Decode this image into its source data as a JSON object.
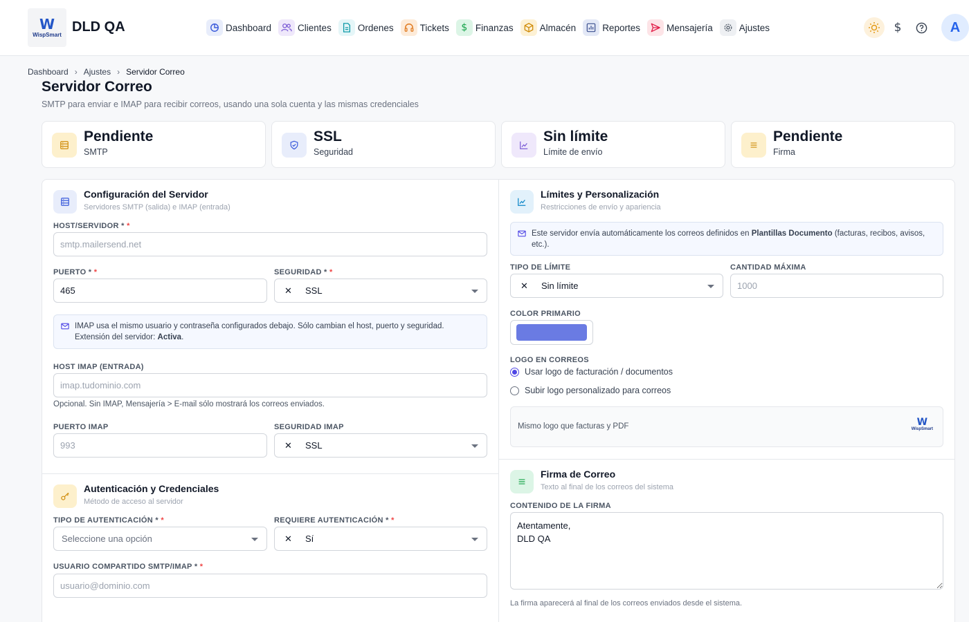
{
  "app": {
    "title": "DLD QA",
    "logo_text": "WispSmart",
    "logo_letter": "W"
  },
  "nav": [
    {
      "label": "Dashboard",
      "icon": "chart-pie-icon",
      "bg": "#e8edfb",
      "fg": "#3b5bdb"
    },
    {
      "label": "Clientes",
      "icon": "users-icon",
      "bg": "#efe8fb",
      "fg": "#7c5cd6"
    },
    {
      "label": "Ordenes",
      "icon": "document-icon",
      "bg": "#e5f6f8",
      "fg": "#0e9aa7"
    },
    {
      "label": "Tickets",
      "icon": "headset-icon",
      "bg": "#fdebd9",
      "fg": "#e07a1f"
    },
    {
      "label": "Finanzas",
      "icon": "dollar-icon",
      "bg": "#dcf5e6",
      "fg": "#16a34a"
    },
    {
      "label": "Almacén",
      "icon": "box-icon",
      "bg": "#fdf1d4",
      "fg": "#d08c0b"
    },
    {
      "label": "Reportes",
      "icon": "bar-chart-icon",
      "bg": "#e3e8f6",
      "fg": "#3b4f8f"
    },
    {
      "label": "Mensajería",
      "icon": "send-icon",
      "bg": "#fde4e7",
      "fg": "#e11d48"
    },
    {
      "label": "Ajustes",
      "icon": "gear-icon",
      "bg": "#eef0f3",
      "fg": "#4b5563"
    }
  ],
  "topright": {
    "avatar_letter": "A"
  },
  "breadcrumb": [
    "Dashboard",
    "Ajustes",
    "Servidor Correo"
  ],
  "page": {
    "title": "Servidor Correo",
    "subtitle": "SMTP para enviar e IMAP para recibir correos, usando una sola cuenta y las mismas credenciales"
  },
  "stats": [
    {
      "value": "Pendiente",
      "label": "SMTP",
      "icon": "server-icon",
      "bg": "#fdf0cc",
      "fg": "#d08c0b"
    },
    {
      "value": "SSL",
      "label": "Seguridad",
      "icon": "shield-icon",
      "bg": "#e8edfb",
      "fg": "#3b5bdb"
    },
    {
      "value": "Sin límite",
      "label": "Límite de envío",
      "icon": "trend-icon",
      "bg": "#efe8fb",
      "fg": "#7c5cd6"
    },
    {
      "value": "Pendiente",
      "label": "Firma",
      "icon": "lines-icon",
      "bg": "#fdf0cc",
      "fg": "#d08c0b"
    }
  ],
  "server": {
    "title": "Configuración del Servidor",
    "subtitle": "Servidores SMTP (salida) e IMAP (entrada)",
    "host_label": "HOST/SERVIDOR *",
    "host_placeholder": "smtp.mailersend.net",
    "port_label": "PUERTO *",
    "port_value": "465",
    "security_label": "SEGURIDAD *",
    "security_value": "SSL",
    "imap_info_1": "IMAP usa el mismo usuario y contraseña configurados debajo. Sólo cambian el host, puerto y seguridad.",
    "imap_info_2": "Extensión del servidor:",
    "imap_info_status": "Activa",
    "imap_host_label": "HOST IMAP (ENTRADA)",
    "imap_host_placeholder": "imap.tudominio.com",
    "imap_hint": "Opcional. Sin IMAP, Mensajería > E-mail sólo mostrará los correos enviados.",
    "imap_port_label": "PUERTO IMAP",
    "imap_port_placeholder": "993",
    "imap_security_label": "SEGURIDAD IMAP",
    "imap_security_value": "SSL"
  },
  "auth": {
    "title": "Autenticación y Credenciales",
    "subtitle": "Método de acceso al servidor",
    "type_label": "TIPO DE AUTENTICACIÓN *",
    "type_placeholder": "Seleccione una opción",
    "required_label": "REQUIERE AUTENTICACIÓN *",
    "required_value": "Sí",
    "user_label": "USUARIO COMPARTIDO SMTP/IMAP *",
    "user_placeholder": "usuario@dominio.com"
  },
  "limits": {
    "title": "Límites y Personalización",
    "subtitle": "Restricciones de envío y apariencia",
    "info_pre": "Este servidor envía automáticamente los correos definidos en",
    "info_bold": "Plantillas Documento",
    "info_post": "(facturas, recibos, avisos, etc.).",
    "limit_type_label": "TIPO DE LÍMITE",
    "limit_type_value": "Sin límite",
    "max_label": "CANTIDAD MÁXIMA",
    "max_placeholder": "1000",
    "color_label": "COLOR PRIMARIO",
    "color_value": "#6a7be3",
    "logo_label": "LOGO EN CORREOS",
    "logo_opt1": "Usar logo de facturación / documentos",
    "logo_opt2": "Subir logo personalizado para correos",
    "logo_preview_text": "Mismo logo que facturas y PDF"
  },
  "signature": {
    "title": "Firma de Correo",
    "subtitle": "Texto al final de los correos del sistema",
    "content_label": "CONTENIDO DE LA FIRMA",
    "content_value": "Atentamente,\nDLD QA",
    "hint": "La firma aparecerá al final de los correos enviados desde el sistema."
  }
}
